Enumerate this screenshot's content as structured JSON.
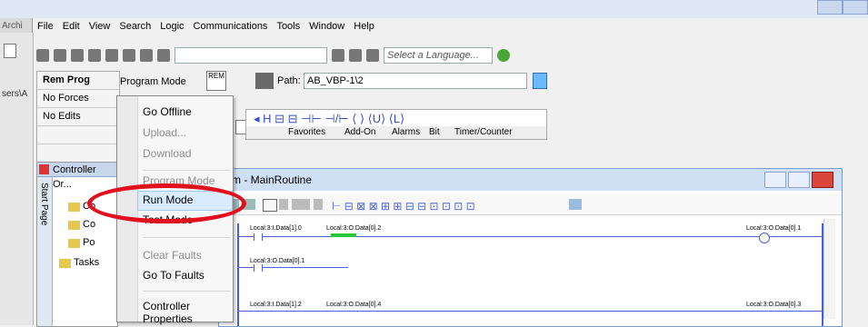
{
  "window": {
    "left_clip_text": "Archi"
  },
  "menubar": {
    "items": [
      "File",
      "Edit",
      "View",
      "Search",
      "Logic",
      "Communications",
      "Tools",
      "Window",
      "Help"
    ]
  },
  "toolbar": {
    "language_placeholder": "Select a Language..."
  },
  "status_panel": {
    "mode_label": "Rem Prog",
    "program_mode_label": "Program Mode",
    "forces_label": "No Forces",
    "edits_label": "No Edits",
    "rem_label": "REM"
  },
  "path": {
    "label": "Path:",
    "value": "AB_VBP-1\\2"
  },
  "instruction_tabs": [
    "Favorites",
    "Add-On",
    "Alarms",
    "Bit",
    "Timer/Counter"
  ],
  "controller_organizer": {
    "title": "Controller Or...",
    "start_page_label": "Start Page",
    "tasks_label": "Tasks",
    "items": [
      "Co",
      "Co",
      "Po"
    ]
  },
  "main_window": {
    "title": "m - MainRoutine"
  },
  "ladder": {
    "row1": [
      "Local:3:I.Data[1].0",
      "Local:3:O.Data[0].2",
      "Local:3:O.Data[0].1"
    ],
    "row2": [
      "Local:3:O.Data[0].1"
    ],
    "row3": [
      "Local:3:I.Data[1].2",
      "Local:3:O.Data[0].4",
      "Local:3:O.Data[0].3"
    ]
  },
  "context_menu": {
    "items": [
      {
        "label": "Go Offline"
      },
      {
        "label": "Upload..."
      },
      {
        "label": "Download"
      },
      {
        "label": "Program Mode"
      },
      {
        "label": "Run Mode"
      },
      {
        "label": "Test Mode"
      },
      {
        "label": "Clear Faults"
      },
      {
        "label": "Go To Faults"
      },
      {
        "label": "Controller Properties"
      }
    ]
  },
  "colors": {
    "highlight_ellipse": "#e0101e",
    "tree_folder": "#e7c84c",
    "coil_green": "#28c63a"
  }
}
